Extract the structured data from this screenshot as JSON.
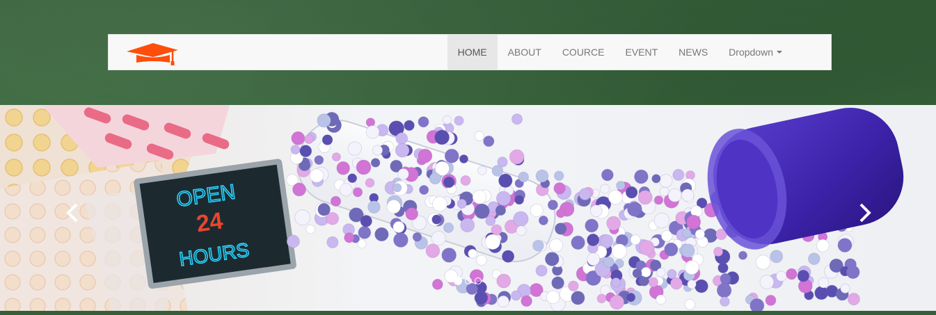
{
  "colors": {
    "background": "#3a6a3d",
    "navbar_bg": "#f8f8f8",
    "active_bg": "#e7e7e7",
    "link": "#777777",
    "logo": "#ff4e0b"
  },
  "navbar": {
    "logo_icon": "graduation-cap-icon",
    "items": [
      {
        "label": "HOME",
        "active": true
      },
      {
        "label": "ABOUT"
      },
      {
        "label": "COURCE"
      },
      {
        "label": "EVENT"
      },
      {
        "label": "NEWS"
      },
      {
        "label": "Dropdown",
        "has_caret": true
      }
    ]
  },
  "carousel": {
    "sign": {
      "line1": "OPEN",
      "line2": "24",
      "line3": "HOURS"
    },
    "prev_icon": "chevron-left-icon",
    "next_icon": "chevron-right-icon",
    "indicators": [
      {
        "active": true
      },
      {
        "active": false
      },
      {
        "active": false
      }
    ]
  }
}
